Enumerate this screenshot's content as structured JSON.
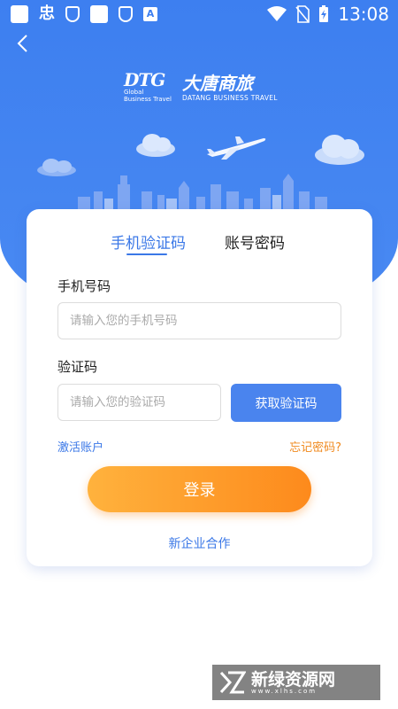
{
  "status_bar": {
    "left_glyph": "忠",
    "time": "13:08",
    "icons": [
      "notification-square-icon",
      "app-glyph-icon",
      "shield-icon",
      "notification-square-icon",
      "shield-icon",
      "font-icon",
      "wifi-icon",
      "no-sim-icon",
      "battery-charging-icon"
    ]
  },
  "header": {
    "logo_mark": "DTG",
    "logo_sub1": "Global",
    "logo_sub2": "Business Travel",
    "logo_cn": "大唐商旅",
    "logo_en": "DATANG BUSINESS TRAVEL"
  },
  "tabs": [
    {
      "label": "手机验证码",
      "active": true
    },
    {
      "label": "账号密码",
      "active": false
    }
  ],
  "form": {
    "phone_label": "手机号码",
    "phone_placeholder": "请输入您的手机号码",
    "code_label": "验证码",
    "code_placeholder": "请输入您的验证码",
    "get_code_button": "获取验证码",
    "activate_link": "激活账户",
    "forgot_link": "忘记密码?",
    "login_button": "登录",
    "cooperation_link": "新企业合作"
  },
  "watermark": {
    "text": "新绿资源网",
    "url": "www.xlhs.com"
  },
  "colors": {
    "primary_blue": "#3b78e7",
    "header_blue": "#3d7ff0",
    "accent_orange": "#fd8a1c"
  }
}
